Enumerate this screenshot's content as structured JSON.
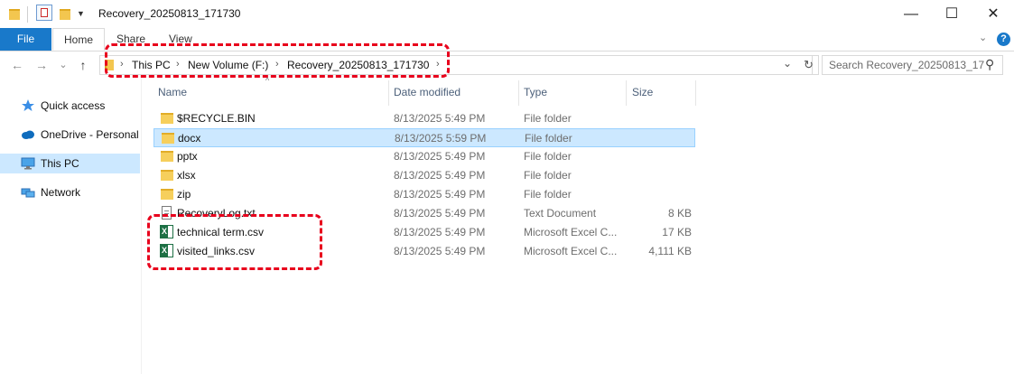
{
  "window": {
    "title": "Recovery_20250813_171730",
    "controls": {
      "minimize": "—",
      "maximize": "☐",
      "close": "✕"
    }
  },
  "ribbon": {
    "tabs": [
      {
        "label": "File"
      },
      {
        "label": "Home"
      },
      {
        "label": "Share"
      },
      {
        "label": "View"
      }
    ],
    "collapse_glyph": "⌄",
    "help_glyph": "?"
  },
  "nav": {
    "back": "←",
    "forward": "→",
    "recent": "⌄",
    "up": "↑",
    "breadcrumb": [
      "This PC",
      "New Volume (F:)",
      "Recovery_20250813_171730"
    ],
    "separator": "›",
    "dropdown": "⌄",
    "refresh": "↻",
    "search_placeholder": "Search Recovery_20250813_17...",
    "search_icon": "⚲"
  },
  "sidebar": {
    "items": [
      {
        "label": "Quick access",
        "icon": "star-icon"
      },
      {
        "label": "OneDrive - Personal",
        "icon": "cloud-icon"
      },
      {
        "label": "This PC",
        "icon": "monitor-icon",
        "selected": true
      },
      {
        "label": "Network",
        "icon": "network-icon"
      }
    ]
  },
  "columns": {
    "name": "Name",
    "date": "Date modified",
    "type": "Type",
    "size": "Size",
    "sort_glyph": "^"
  },
  "files": [
    {
      "name": "$RECYCLE.BIN",
      "date": "8/13/2025 5:49 PM",
      "type": "File folder",
      "size": "",
      "icon": "folder-icon"
    },
    {
      "name": "docx",
      "date": "8/13/2025 5:59 PM",
      "type": "File folder",
      "size": "",
      "icon": "folder-icon",
      "selected": true
    },
    {
      "name": "pptx",
      "date": "8/13/2025 5:49 PM",
      "type": "File folder",
      "size": "",
      "icon": "folder-icon"
    },
    {
      "name": "xlsx",
      "date": "8/13/2025 5:49 PM",
      "type": "File folder",
      "size": "",
      "icon": "folder-icon"
    },
    {
      "name": "zip",
      "date": "8/13/2025 5:49 PM",
      "type": "File folder",
      "size": "",
      "icon": "folder-icon"
    },
    {
      "name": "RecoveryLog.txt",
      "date": "8/13/2025 5:49 PM",
      "type": "Text Document",
      "size": "8 KB",
      "icon": "text-file-icon"
    },
    {
      "name": "technical term.csv",
      "date": "8/13/2025 5:49 PM",
      "type": "Microsoft Excel C...",
      "size": "17 KB",
      "icon": "excel-file-icon"
    },
    {
      "name": "visited_links.csv",
      "date": "8/13/2025 5:49 PM",
      "type": "Microsoft Excel C...",
      "size": "4,111 KB",
      "icon": "excel-file-icon"
    }
  ],
  "colors": {
    "accent": "#1979ca",
    "selection": "#cce8ff",
    "highlight_annotation": "#e8001c"
  }
}
